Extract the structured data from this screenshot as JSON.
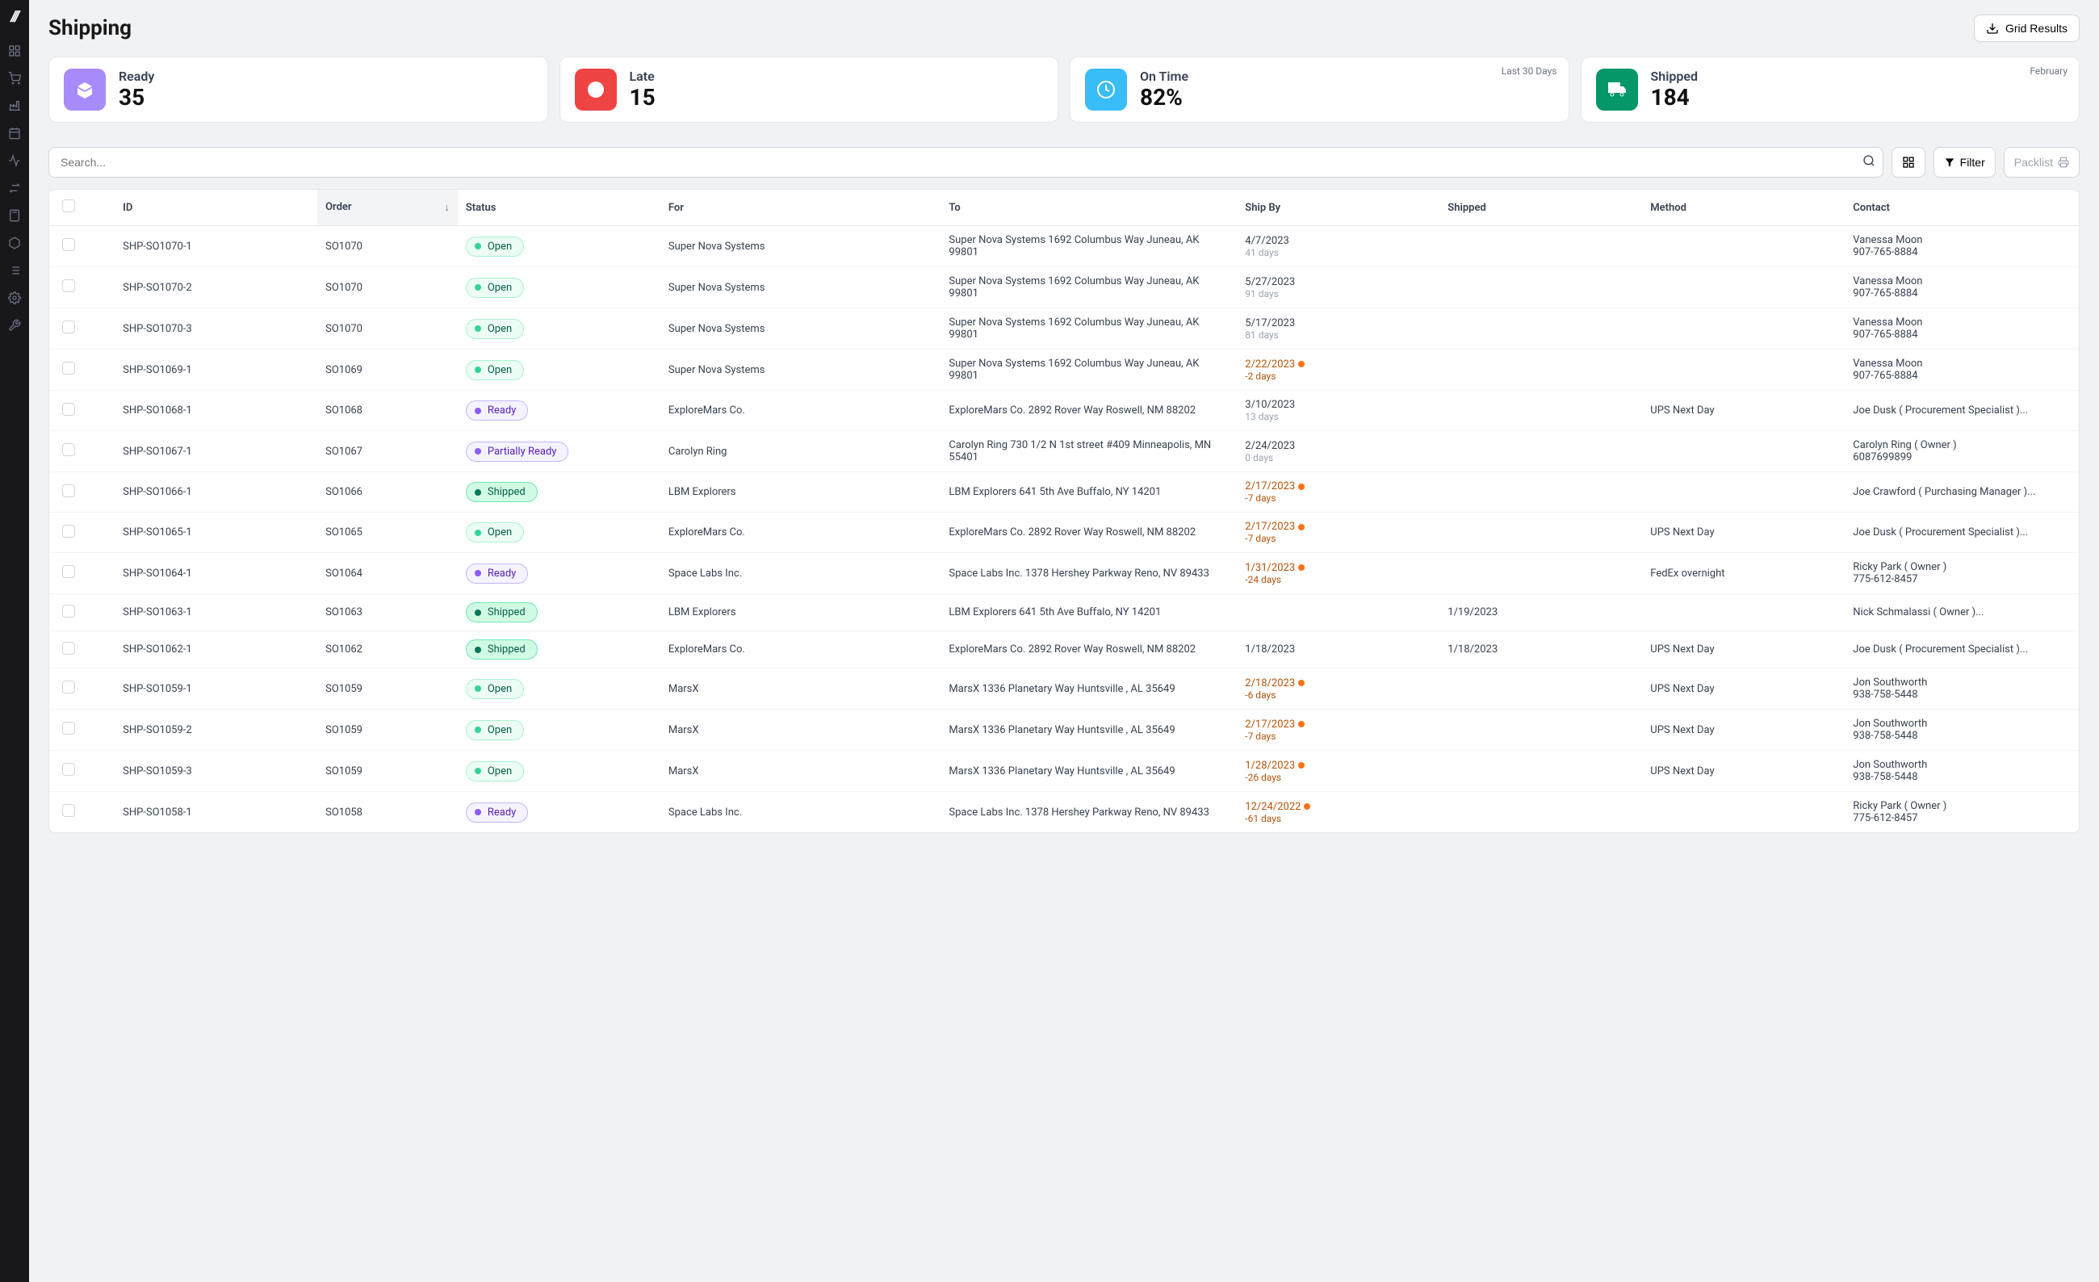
{
  "page_title": "Shipping",
  "grid_results_label": "Grid Results",
  "cards": [
    {
      "label": "Ready",
      "value": "35",
      "icon": "box",
      "color": "purple",
      "meta": ""
    },
    {
      "label": "Late",
      "value": "15",
      "icon": "alert",
      "color": "red",
      "meta": ""
    },
    {
      "label": "On Time",
      "value": "82%",
      "icon": "clock",
      "color": "blue",
      "meta": "Last 30 Days"
    },
    {
      "label": "Shipped",
      "value": "184",
      "icon": "truck",
      "color": "green",
      "meta": "February"
    }
  ],
  "search": {
    "placeholder": "Search..."
  },
  "toolbar": {
    "filter_label": "Filter",
    "packlist_label": "Packlist"
  },
  "columns": [
    "ID",
    "Order",
    "Status",
    "For",
    "To",
    "Ship By",
    "Shipped",
    "Method",
    "Contact"
  ],
  "sorted_column": "Order",
  "rows": [
    {
      "id": "SHP-SO1070-1",
      "order": "SO1070",
      "status": "Open",
      "for": "Super Nova Systems",
      "to": "Super Nova Systems 1692 Columbus Way Juneau, AK 99801",
      "ship_by": "4/7/2023",
      "ship_by_sub": "41 days",
      "late": false,
      "shipped": "",
      "method": "",
      "contact": "Vanessa Moon",
      "contact_sub": "907-765-8884"
    },
    {
      "id": "SHP-SO1070-2",
      "order": "SO1070",
      "status": "Open",
      "for": "Super Nova Systems",
      "to": "Super Nova Systems 1692 Columbus Way Juneau, AK 99801",
      "ship_by": "5/27/2023",
      "ship_by_sub": "91 days",
      "late": false,
      "shipped": "",
      "method": "",
      "contact": "Vanessa Moon",
      "contact_sub": "907-765-8884"
    },
    {
      "id": "SHP-SO1070-3",
      "order": "SO1070",
      "status": "Open",
      "for": "Super Nova Systems",
      "to": "Super Nova Systems 1692 Columbus Way Juneau, AK 99801",
      "ship_by": "5/17/2023",
      "ship_by_sub": "81 days",
      "late": false,
      "shipped": "",
      "method": "",
      "contact": "Vanessa Moon",
      "contact_sub": "907-765-8884"
    },
    {
      "id": "SHP-SO1069-1",
      "order": "SO1069",
      "status": "Open",
      "for": "Super Nova Systems",
      "to": "Super Nova Systems 1692 Columbus Way Juneau, AK 99801",
      "ship_by": "2/22/2023",
      "ship_by_sub": "-2 days",
      "late": true,
      "shipped": "",
      "method": "",
      "contact": "Vanessa Moon",
      "contact_sub": "907-765-8884"
    },
    {
      "id": "SHP-SO1068-1",
      "order": "SO1068",
      "status": "Ready",
      "for": "ExploreMars Co.",
      "to": "ExploreMars Co. 2892 Rover Way Roswell, NM 88202",
      "ship_by": "3/10/2023",
      "ship_by_sub": "13 days",
      "late": false,
      "shipped": "",
      "method": "UPS Next Day",
      "contact": "Joe Dusk ( Procurement Specialist )...",
      "contact_sub": ""
    },
    {
      "id": "SHP-SO1067-1",
      "order": "SO1067",
      "status": "Partially Ready",
      "for": "Carolyn Ring",
      "to": "Carolyn Ring 730 1/2 N 1st street #409 Minneapolis, MN 55401",
      "ship_by": "2/24/2023",
      "ship_by_sub": "0 days",
      "late": false,
      "shipped": "",
      "method": "",
      "contact": "Carolyn Ring ( Owner )",
      "contact_sub": "6087699899"
    },
    {
      "id": "SHP-SO1066-1",
      "order": "SO1066",
      "status": "Shipped",
      "for": "LBM Explorers",
      "to": "LBM Explorers 641 5th Ave Buffalo, NY 14201",
      "ship_by": "2/17/2023",
      "ship_by_sub": "-7 days",
      "late": true,
      "shipped": "",
      "method": "",
      "contact": "Joe Crawford ( Purchasing Manager )...",
      "contact_sub": ""
    },
    {
      "id": "SHP-SO1065-1",
      "order": "SO1065",
      "status": "Open",
      "for": "ExploreMars Co.",
      "to": "ExploreMars Co. 2892 Rover Way Roswell, NM 88202",
      "ship_by": "2/17/2023",
      "ship_by_sub": "-7 days",
      "late": true,
      "shipped": "",
      "method": "UPS Next Day",
      "contact": "Joe Dusk ( Procurement Specialist )...",
      "contact_sub": ""
    },
    {
      "id": "SHP-SO1064-1",
      "order": "SO1064",
      "status": "Ready",
      "for": "Space Labs Inc.",
      "to": "Space Labs Inc. 1378 Hershey Parkway Reno, NV 89433",
      "ship_by": "1/31/2023",
      "ship_by_sub": "-24 days",
      "late": true,
      "shipped": "",
      "method": "FedEx overnight",
      "contact": "Ricky Park ( Owner )",
      "contact_sub": "775-612-8457"
    },
    {
      "id": "SHP-SO1063-1",
      "order": "SO1063",
      "status": "Shipped",
      "for": "LBM Explorers",
      "to": "LBM Explorers 641 5th Ave Buffalo, NY 14201",
      "ship_by": "",
      "ship_by_sub": "",
      "late": false,
      "shipped": "1/19/2023",
      "method": "",
      "contact": "Nick Schmalassi ( Owner )...",
      "contact_sub": ""
    },
    {
      "id": "SHP-SO1062-1",
      "order": "SO1062",
      "status": "Shipped",
      "for": "ExploreMars Co.",
      "to": "ExploreMars Co. 2892 Rover Way Roswell, NM 88202",
      "ship_by": "1/18/2023",
      "ship_by_sub": "",
      "late": false,
      "ship_by_muted": true,
      "shipped": "1/18/2023",
      "method": "UPS Next Day",
      "contact": "Joe Dusk ( Procurement Specialist )...",
      "contact_sub": ""
    },
    {
      "id": "SHP-SO1059-1",
      "order": "SO1059",
      "status": "Open",
      "for": "MarsX",
      "to": "MarsX 1336 Planetary Way Huntsville , AL 35649",
      "ship_by": "2/18/2023",
      "ship_by_sub": "-6 days",
      "late": true,
      "shipped": "",
      "method": "UPS Next Day",
      "contact": "Jon Southworth",
      "contact_sub": "938-758-5448"
    },
    {
      "id": "SHP-SO1059-2",
      "order": "SO1059",
      "status": "Open",
      "for": "MarsX",
      "to": "MarsX 1336 Planetary Way Huntsville , AL 35649",
      "ship_by": "2/17/2023",
      "ship_by_sub": "-7 days",
      "late": true,
      "shipped": "",
      "method": "UPS Next Day",
      "contact": "Jon Southworth",
      "contact_sub": "938-758-5448"
    },
    {
      "id": "SHP-SO1059-3",
      "order": "SO1059",
      "status": "Open",
      "for": "MarsX",
      "to": "MarsX 1336 Planetary Way Huntsville , AL 35649",
      "ship_by": "1/28/2023",
      "ship_by_sub": "-26 days",
      "late": true,
      "shipped": "",
      "method": "UPS Next Day",
      "contact": "Jon Southworth",
      "contact_sub": "938-758-5448"
    },
    {
      "id": "SHP-SO1058-1",
      "order": "SO1058",
      "status": "Ready",
      "for": "Space Labs Inc.",
      "to": "Space Labs Inc. 1378 Hershey Parkway Reno, NV 89433",
      "ship_by": "12/24/2022",
      "ship_by_sub": "-61 days",
      "late": true,
      "shipped": "",
      "method": "",
      "contact": "Ricky Park ( Owner )",
      "contact_sub": "775-612-8457"
    }
  ]
}
